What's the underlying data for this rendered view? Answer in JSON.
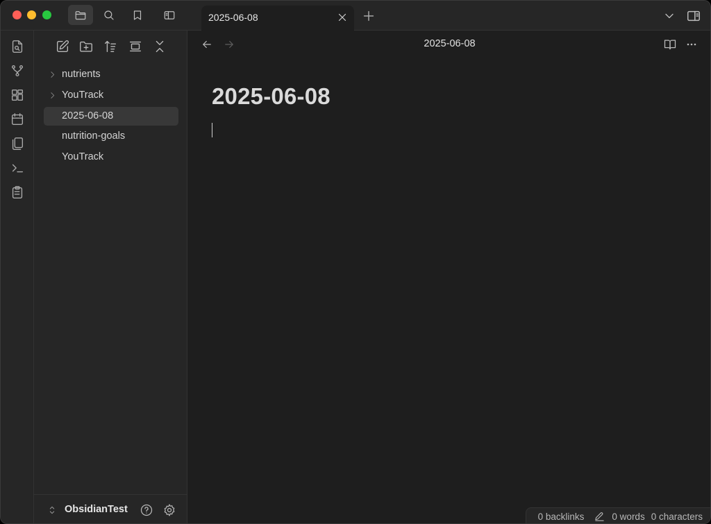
{
  "tab": {
    "title": "2025-06-08"
  },
  "ribbon": {
    "icons": [
      "open-quick-switcher-icon",
      "graph-view-icon",
      "canvas-icon",
      "daily-note-icon",
      "templates-icon",
      "command-palette-icon",
      "clipboard-icon"
    ]
  },
  "sidebar": {
    "items": [
      {
        "label": "nutrients",
        "type": "folder"
      },
      {
        "label": "YouTrack",
        "type": "folder"
      },
      {
        "label": "2025-06-08",
        "type": "file",
        "active": true
      },
      {
        "label": "nutrition-goals",
        "type": "file"
      },
      {
        "label": "YouTrack",
        "type": "file"
      }
    ],
    "vault_name": "ObsidianTest"
  },
  "main": {
    "view_title": "2025-06-08",
    "note_title": "2025-06-08"
  },
  "status_bar": {
    "backlinks": "0 backlinks",
    "words": "0 words",
    "characters": "0 characters"
  },
  "colors": {
    "background": "#1e1e1e",
    "panel": "#262626",
    "active_item": "#383838",
    "text": "#dadada"
  }
}
